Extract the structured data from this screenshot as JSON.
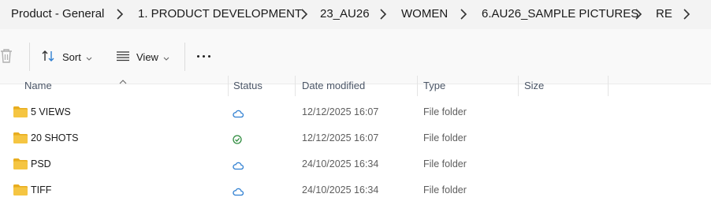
{
  "breadcrumb": {
    "items": [
      "Product - General",
      "1. PRODUCT DEVELOPMENT",
      "23_AU26",
      "WOMEN",
      "6.AU26_SAMPLE PICTURES",
      "RE"
    ]
  },
  "toolbar": {
    "sort_label": "Sort",
    "view_label": "View",
    "more_label": "See more"
  },
  "columns": {
    "name": "Name",
    "status": "Status",
    "date_modified": "Date modified",
    "type": "Type",
    "size": "Size"
  },
  "rows": [
    {
      "name": "5 VIEWS",
      "status": "cloud",
      "date_modified": "12/12/2025 16:07",
      "type": "File folder",
      "size": ""
    },
    {
      "name": "20 SHOTS",
      "status": "synced",
      "date_modified": "12/12/2025 16:07",
      "type": "File folder",
      "size": ""
    },
    {
      "name": "PSD",
      "status": "cloud",
      "date_modified": "24/10/2025 16:34",
      "type": "File folder",
      "size": ""
    },
    {
      "name": "TIFF",
      "status": "cloud",
      "date_modified": "24/10/2025 16:34",
      "type": "File folder",
      "size": ""
    }
  ],
  "colors": {
    "cloud_icon": "#2f7fd1",
    "synced_icon": "#2e8b3e",
    "folder_body": "#f5c542",
    "folder_tab": "#e8ad1f"
  }
}
